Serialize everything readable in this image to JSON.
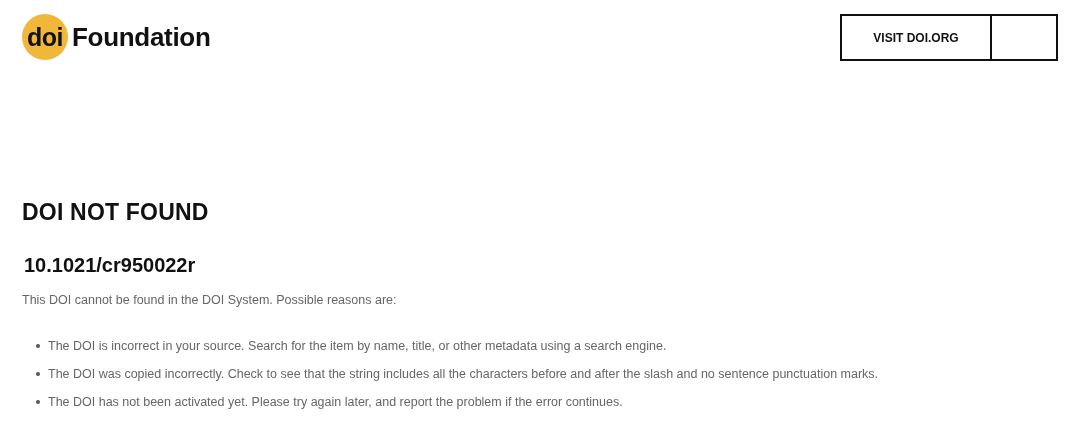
{
  "header": {
    "logo_mark": "doi",
    "logo_text": "Foundation",
    "visit_button": "VISIT DOI.ORG"
  },
  "title": "DOI NOT FOUND",
  "doi": "10.1021/cr950022r",
  "intro": "This DOI cannot be found in the DOI System. Possible reasons are:",
  "reasons": [
    "The DOI is incorrect in your source. Search for the item by name, title, or other metadata using a search engine.",
    "The DOI was copied incorrectly. Check to see that the string includes all the characters before and after the slash and no sentence punctuation marks.",
    "The DOI has not been activated yet. Please try again later, and report the problem if the error continues."
  ]
}
